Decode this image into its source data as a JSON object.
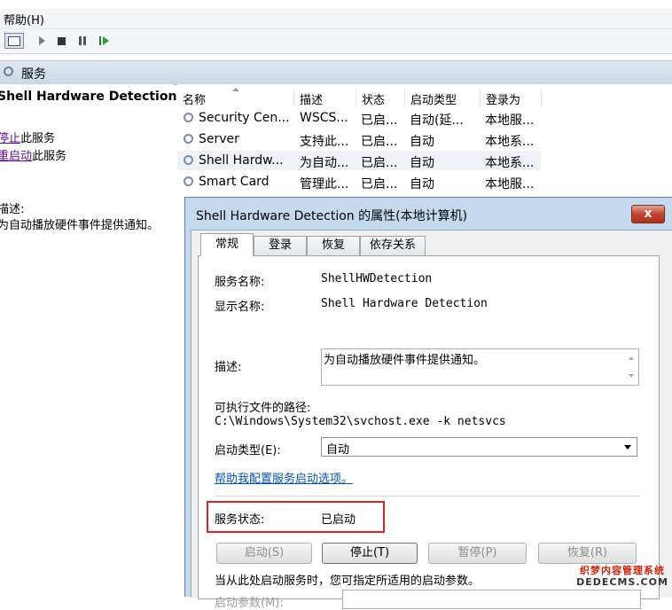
{
  "menubar": {
    "help": "帮助(H)"
  },
  "toolbar": {
    "icons": [
      "console-icon",
      "play-icon",
      "stop-icon",
      "pause-icon",
      "restart-icon"
    ]
  },
  "services_header": {
    "title": "服务"
  },
  "left_panel": {
    "service_title": "Shell Hardware Detection",
    "stop_link": "停止",
    "stop_suffix": "此服务",
    "restart_link": "重启动",
    "restart_suffix": "此服务",
    "desc_label": "描述:",
    "desc_text": "为自动播放硬件事件提供通知。"
  },
  "list": {
    "columns": [
      "名称",
      "描述",
      "状态",
      "启动类型",
      "登录为"
    ],
    "rows": [
      {
        "name": "Security Cen...",
        "desc": "WSCS...",
        "status": "已启...",
        "startup": "自动(延...",
        "logon": "本地服..."
      },
      {
        "name": "Server",
        "desc": "支持此...",
        "status": "已启...",
        "startup": "自动",
        "logon": "本地系..."
      },
      {
        "name": "Shell Hardw...",
        "desc": "为自动...",
        "status": "已启...",
        "startup": "自动",
        "logon": "本地系..."
      },
      {
        "name": "Smart Card",
        "desc": "管理此...",
        "status": "已启...",
        "startup": "自动",
        "logon": "本地服..."
      }
    ],
    "selected_row": 2
  },
  "dialog": {
    "title": "Shell Hardware Detection 的属性(本地计算机)",
    "close": "x",
    "tabs": [
      "常规",
      "登录",
      "恢复",
      "依存关系"
    ],
    "active_tab": 0,
    "service_name_label": "服务名称:",
    "service_name": "ShellHWDetection",
    "display_name_label": "显示名称:",
    "display_name": "Shell Hardware Detection",
    "description_label": "描述:",
    "description": "为自动播放硬件事件提供通知。",
    "path_label": "可执行文件的路径:",
    "path": "C:\\Windows\\System32\\svchost.exe -k netsvcs",
    "startup_type_label": "启动类型(E):",
    "startup_type": "自动",
    "help_link": "帮助我配置服务启动选项。",
    "status_label": "服务状态:",
    "status_value": "已启动",
    "buttons": {
      "start": "启动(S)",
      "stop": "停止(T)",
      "pause": "暂停(P)",
      "resume": "恢复(R)"
    },
    "hint": "当从此处启动服务时，您可指定所适用的启动参数。",
    "params_label": "启动参数(M):"
  },
  "watermark": {
    "line1": "织梦内容管理系统",
    "line2": "DEDECMS.COM"
  },
  "colors": {
    "status_highlight": "#e0212b",
    "dialog_frame": "#c4d8ee",
    "link": "#0052b8"
  }
}
